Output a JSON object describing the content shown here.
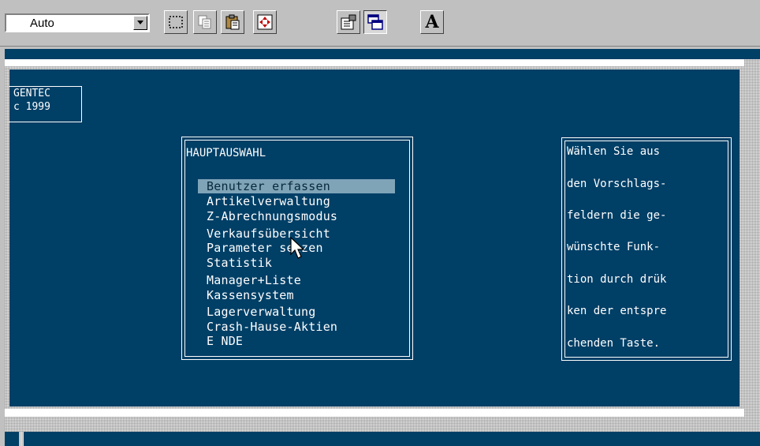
{
  "toolbar": {
    "font_size_value": "Auto",
    "buttons": [
      {
        "name": "mark-icon"
      },
      {
        "name": "copy-icon"
      },
      {
        "name": "paste-icon"
      },
      {
        "name": "fullscreen-icon"
      },
      {
        "name": "properties-icon"
      },
      {
        "name": "background-icon"
      },
      {
        "name": "font-icon",
        "glyph": "A"
      }
    ]
  },
  "logo": {
    "line1": "GENTEC",
    "line2": "c 1999"
  },
  "menu": {
    "title": "HAUPTAUSWAHL",
    "selected_color": "#7fa4b8",
    "items": [
      "Benutzer erfassen",
      "Artikelverwaltung",
      "Z-Abrechnungsmodus",
      "Verkaufsübersicht",
      "Parameter setzen",
      "Statistik",
      "Manager+Liste",
      "Kassensystem",
      "Lagerverwaltung",
      "Crash-Hause-Aktien",
      "E NDE"
    ]
  },
  "info": {
    "lines": [
      "Wählen Sie aus",
      "den Vorschlags-",
      "feldern die ge-",
      "wünschte Funk-",
      "tion durch drük",
      "ken der entspre",
      "chenden Taste."
    ]
  },
  "colors": {
    "screen_background": "#003f66",
    "text": "#ffffff"
  }
}
